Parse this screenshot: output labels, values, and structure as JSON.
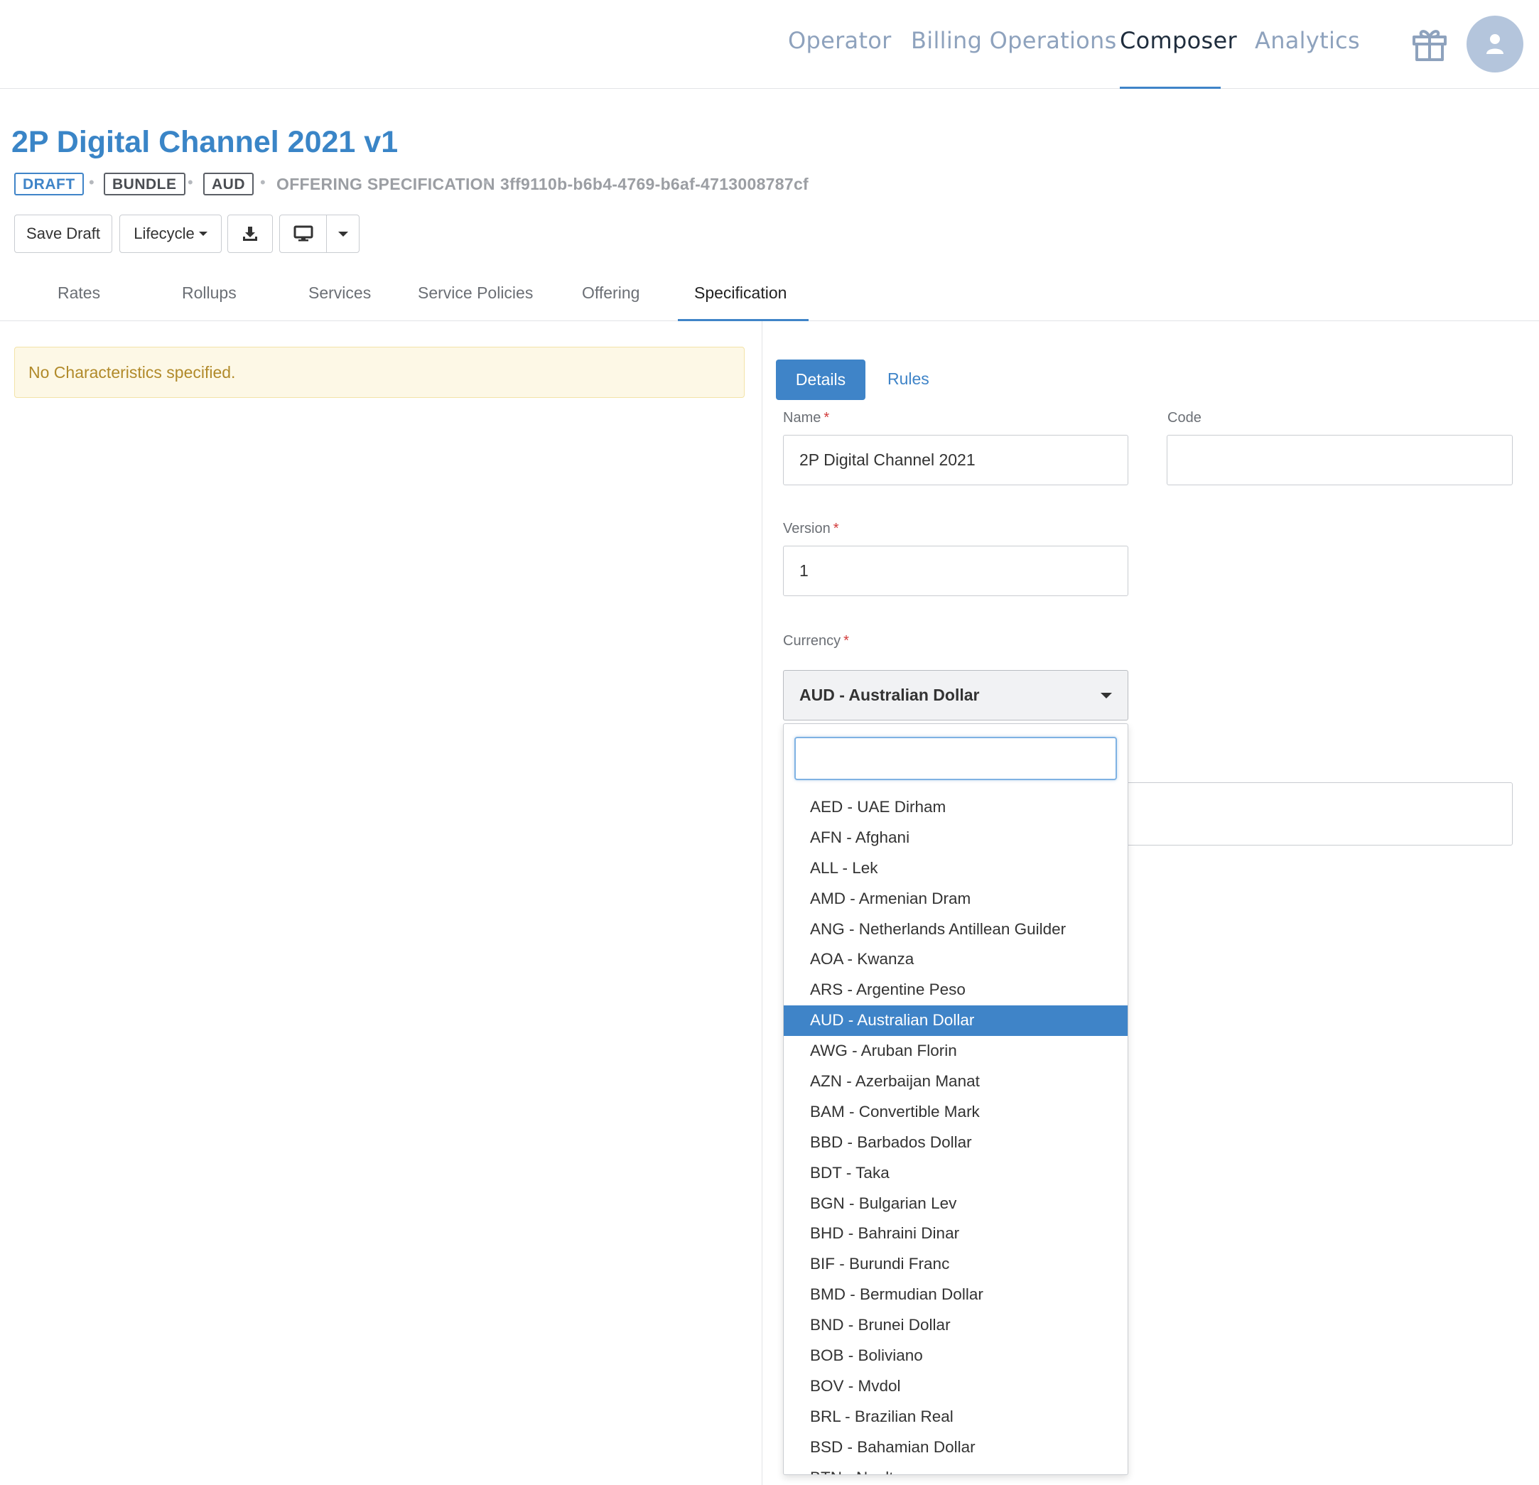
{
  "nav": {
    "links": [
      "Operator",
      "Billing Operations",
      "Composer",
      "Analytics"
    ],
    "active": "Composer",
    "icons": [
      "gift-icon",
      "user-icon"
    ]
  },
  "header": {
    "title": "2P Digital Channel 2021 v1",
    "badges": [
      "DRAFT",
      "BUNDLE",
      "AUD"
    ],
    "type_label": "OFFERING SPECIFICATION",
    "id": "3ff9110b-b6b4-4769-b6af-4713008787cf"
  },
  "toolbar": {
    "save_label": "Save Draft",
    "lifecycle_label": "Lifecycle",
    "icons": [
      "download-icon",
      "desktop-icon",
      "caret-down-icon"
    ]
  },
  "tabs": [
    "Rates",
    "Rollups",
    "Services",
    "Service Policies",
    "Offering",
    "Specification"
  ],
  "active_tab": "Specification",
  "left_panel": {
    "alert": "No Characteristics specified."
  },
  "right_panel": {
    "subtabs": [
      "Details",
      "Rules"
    ],
    "active_subtab": "Details",
    "name_label": "Name",
    "name_value": "2P Digital Channel 2021",
    "code_label": "Code",
    "code_value": "",
    "version_label": "Version",
    "version_value": "1",
    "currency_label": "Currency",
    "currency_value": "AUD - Australian Dollar",
    "required_mark": "*"
  },
  "currency_dropdown": {
    "search_value": "",
    "selected": "AUD - Australian Dollar",
    "options": [
      "AED - UAE Dirham",
      "AFN - Afghani",
      "ALL - Lek",
      "AMD - Armenian Dram",
      "ANG - Netherlands Antillean Guilder",
      "AOA - Kwanza",
      "ARS - Argentine Peso",
      "AUD - Australian Dollar",
      "AWG - Aruban Florin",
      "AZN - Azerbaijan Manat",
      "BAM - Convertible Mark",
      "BBD - Barbados Dollar",
      "BDT - Taka",
      "BGN - Bulgarian Lev",
      "BHD - Bahraini Dinar",
      "BIF - Burundi Franc",
      "BMD - Bermudian Dollar",
      "BND - Brunei Dollar",
      "BOB - Boliviano",
      "BOV - Mvdol",
      "BRL - Brazilian Real",
      "BSD - Bahamian Dollar",
      "BTN - Ngultrum"
    ]
  },
  "colors": {
    "accent": "#3f84c8",
    "nav_inactive": "#8ea2bd",
    "alert_bg": "#fdf8e6",
    "alert_text": "#b18a2a",
    "required": "#d23b3b"
  }
}
